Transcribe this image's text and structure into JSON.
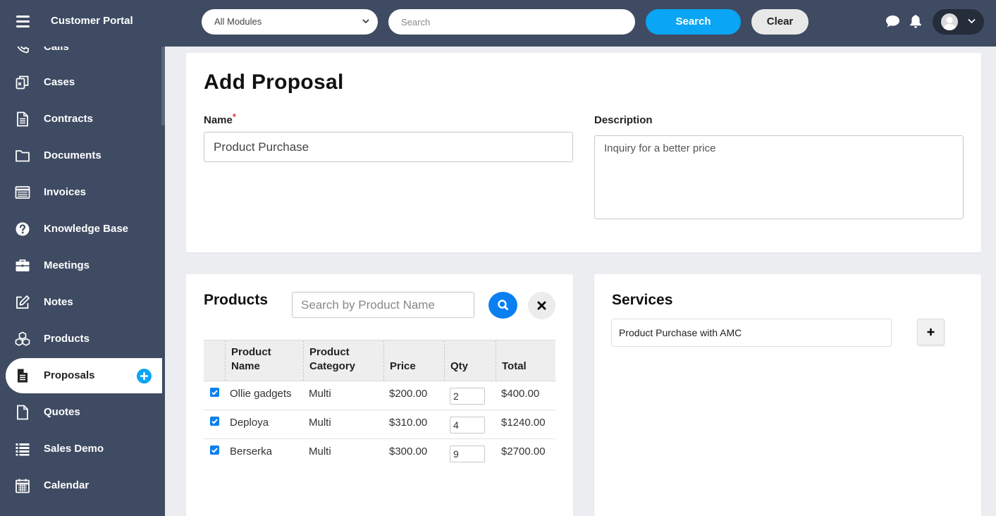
{
  "header": {
    "brand": "Customer Portal",
    "module_select": "All Modules",
    "search_placeholder": "Search",
    "search_label": "Search",
    "clear_label": "Clear"
  },
  "sidebar": {
    "partial_item": "Calls",
    "items": [
      {
        "label": "Cases",
        "icon": "cases-icon"
      },
      {
        "label": "Contracts",
        "icon": "contracts-icon"
      },
      {
        "label": "Documents",
        "icon": "folder-icon"
      },
      {
        "label": "Invoices",
        "icon": "invoice-icon"
      },
      {
        "label": "Knowledge Base",
        "icon": "question-icon"
      },
      {
        "label": "Meetings",
        "icon": "briefcase-icon"
      },
      {
        "label": "Notes",
        "icon": "edit-icon"
      },
      {
        "label": "Products",
        "icon": "cubes-icon"
      },
      {
        "label": "Proposals",
        "icon": "proposal-icon",
        "active": true
      },
      {
        "label": "Quotes",
        "icon": "quote-icon"
      },
      {
        "label": "Sales Demo",
        "icon": "list-icon"
      },
      {
        "label": "Calendar",
        "icon": "calendar-icon"
      }
    ]
  },
  "form": {
    "title": "Add Proposal",
    "name_label": "Name",
    "name_required": "*",
    "name_value": "Product Purchase",
    "description_label": "Description",
    "description_value": "Inquiry for a better price"
  },
  "products": {
    "title": "Products",
    "search_placeholder": "Search by Product Name",
    "columns": [
      "Product Name",
      "Product Category",
      "Price",
      "Qty",
      "Total"
    ],
    "rows": [
      {
        "checked": true,
        "name": "Ollie gadgets",
        "category": "Multi",
        "price": "$200.00",
        "qty": "2",
        "total": "$400.00"
      },
      {
        "checked": true,
        "name": "Deploya",
        "category": "Multi",
        "price": "$310.00",
        "qty": "4",
        "total": "$1240.00"
      },
      {
        "checked": true,
        "name": "Berserka",
        "category": "Multi",
        "price": "$300.00",
        "qty": "9",
        "total": "$2700.00"
      }
    ]
  },
  "services": {
    "title": "Services",
    "value": "Product Purchase with AMC"
  },
  "colors": {
    "sidebar_bg": "#3e4b62",
    "accent_blue": "#0aa5f5",
    "button_blue": "#0a7ff0",
    "page_bg": "#ecedf1"
  }
}
